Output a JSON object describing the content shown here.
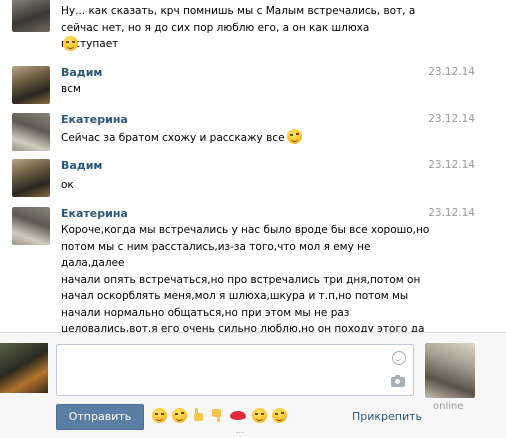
{
  "messages": [
    {
      "author": "",
      "date": "",
      "text": "Ну... как сказать, крч помнишь мы с Малым встречались, вот, а\nсейчас нет, но я до сих пор люблю его, а он как шлюха поступает",
      "emoji": "smile-emoji"
    },
    {
      "author": "Вадим",
      "date": "23.12.14",
      "text": "всм",
      "emoji": ""
    },
    {
      "author": "Екатерина",
      "date": "23.12.14",
      "text": "Сейчас за братом схожу и расскажу все",
      "emoji": "wink-emoji"
    },
    {
      "author": "Вадим",
      "date": "23.12.14",
      "text": "ок",
      "emoji": ""
    },
    {
      "author": "Екатерина",
      "date": "23.12.14",
      "text": "Короче,когда мы встречались у нас было вроде бы все хорошо,но\nпотом мы с ним расстались,из-за того,что мол я ему не дала,далее\nначали опять встречаться,но про встречались три дня,потом он\nначал оскорблять меня,мол я шлюха,шкура и т.п,но потом мы\nначали нормально общаться,но при этом мы не раз\nцеловались,вот,я его очень сильно люблю,но он походу этого да\nсих пор не понимает",
      "emoji": "smile-emoji"
    }
  ],
  "composer": {
    "input_value": "",
    "send_label": "Отправить",
    "attach_label": "Прикрепить",
    "friend_status": "online",
    "emoji_bar": [
      "smile-emoji",
      "blush-emoji",
      "thumbs-up-emoji",
      "thumbs-down-emoji",
      "kiss-lips-emoji",
      "sad-emoji",
      "smirk-emoji"
    ]
  },
  "colors": {
    "author_link": "#2b587a",
    "date": "#999999",
    "send_button": "#597da3",
    "composer_bg": "#f7f7f7",
    "input_border": "#c0cad5"
  }
}
